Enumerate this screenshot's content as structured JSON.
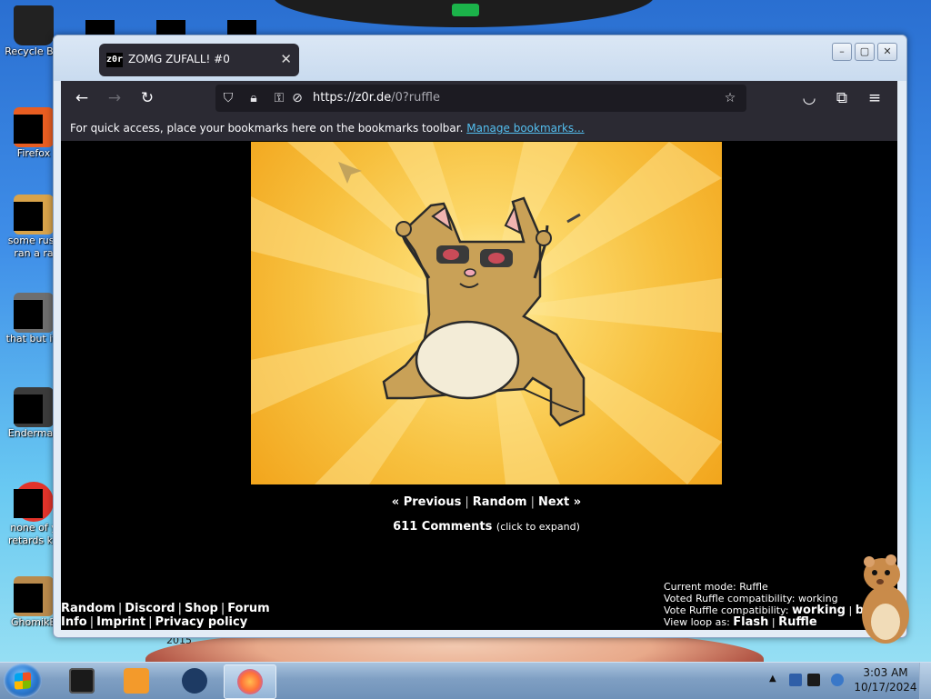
{
  "desktop": {
    "icons": [
      {
        "label": "Recycle Bin",
        "color": "#1e1e1e"
      },
      {
        "label": "Firefox",
        "color": "#e85d21"
      },
      {
        "label": "some russ",
        "label2": "ran a ra",
        "color": "#d8a34a"
      },
      {
        "label": "that but its",
        "color": "#6e6e6e"
      },
      {
        "label": "Enderman",
        "color": "#3b3b3b"
      },
      {
        "label": "none of y",
        "label2": "retards kn",
        "color": "#e2332a"
      },
      {
        "label": "GhomikB",
        "color": "#b98a4c"
      }
    ],
    "background_year": "2015"
  },
  "browser": {
    "tab_title": "ZOMG ZUFALL! #0",
    "tab_favicon": "z0r",
    "window_buttons": {
      "minimize": "minimize-icon",
      "maximize": "maximize-icon",
      "close": "close-icon"
    },
    "url_host": "https://z0r.de",
    "url_path": "/0?ruffle",
    "bookmarks_text": "For quick access, place your bookmarks here on the bookmarks toolbar.",
    "bookmarks_link": "Manage bookmarks..."
  },
  "page": {
    "nav": {
      "previous": "« Previous",
      "random": "Random",
      "next": "Next »"
    },
    "comments_count": "611 Comments",
    "comments_hint": "(click to expand)",
    "footer_links_row1": [
      "Random",
      "Discord",
      "Shop",
      "Forum"
    ],
    "footer_links_row2": [
      "Info",
      "Imprint",
      "Privacy policy"
    ],
    "mode": {
      "current_mode": "Current mode: Ruffle",
      "voted": "Voted Ruffle compatibility: working",
      "vote_label": "Vote Ruffle compatibility:",
      "vote_working": "working",
      "vote_broken": "b",
      "loop_label": "View loop as:",
      "loop_flash": "Flash",
      "loop_ruffle": "Ruffle"
    }
  },
  "taskbar": {
    "clock_time": "3:03 AM",
    "clock_date": "10/17/2024",
    "apps": [
      "terminal-app",
      "media-player-app",
      "steam-app",
      "firefox-app"
    ],
    "active_app": "firefox-app"
  },
  "colors": {
    "accent_link": "#54bff0",
    "browser_chrome": "#2b2a33",
    "art_background": "#f7c03e"
  }
}
